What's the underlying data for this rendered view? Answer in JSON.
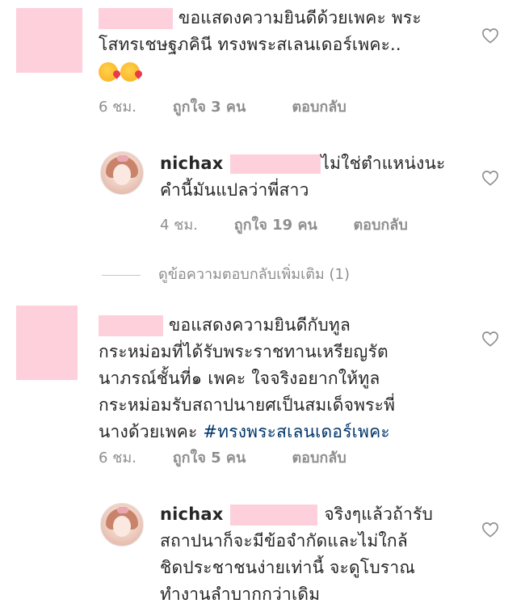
{
  "comments": [
    {
      "text_lines": [
        "ขอแสดงความยินดีด้วยเพคะ  พระ",
        "โสทรเชษฐภคินี ทรงพระสเลนเดอร์เพคะ.."
      ],
      "emoji_count_label": "😘😘",
      "time": "6 ชม.",
      "likes": "ถูกใจ 3 คน",
      "reply": "ตอบกลับ"
    },
    {
      "username": "nichax",
      "text_lines": [
        "ไม่ใช่ตำแหน่งนะ",
        "คำนี้มันแปลว่าพี่สาว"
      ],
      "time": "4 ชม.",
      "likes": "ถูกใจ 19 คน",
      "reply": "ตอบกลับ"
    },
    {
      "text_lines": [
        "ขอแสดงความยินดีกับทูล",
        "กระหม่อมที่ได้รับพระราชทานเหรียญรัต",
        "นาภรณ์ชั้นที่๑ เพคะ ใจจริงอยากให้ทูล",
        "กระหม่อมรับสถาปนายศเป็นสมเด็จพระพี่",
        "นางด้วยเพคะ"
      ],
      "hashtag": "#ทรงพระสเลนเดอร์เพคะ",
      "time": "6 ชม.",
      "likes": "ถูกใจ 5 คน",
      "reply": "ตอบกลับ"
    },
    {
      "username": "nichax",
      "text_lines": [
        "จริงๆแล้วถ้ารับ",
        "สถาปนาก็จะมีข้อจำกัดและไม่ใกล้",
        "ชิดประชาชนง่ายเท่านี้ จะดูโบราณ",
        "ทำงานลำบากกว่าเดิม"
      ]
    }
  ],
  "view_more_replies": "ดูข้อความตอบกลับเพิ่มเติม (1)",
  "colors": {
    "text": "#262626",
    "meta": "#8e8e8e",
    "hashtag": "#003569",
    "redaction": "#fdd0dc"
  },
  "icons": [
    "heart-outline-icon",
    "kiss-emoji-icon"
  ]
}
